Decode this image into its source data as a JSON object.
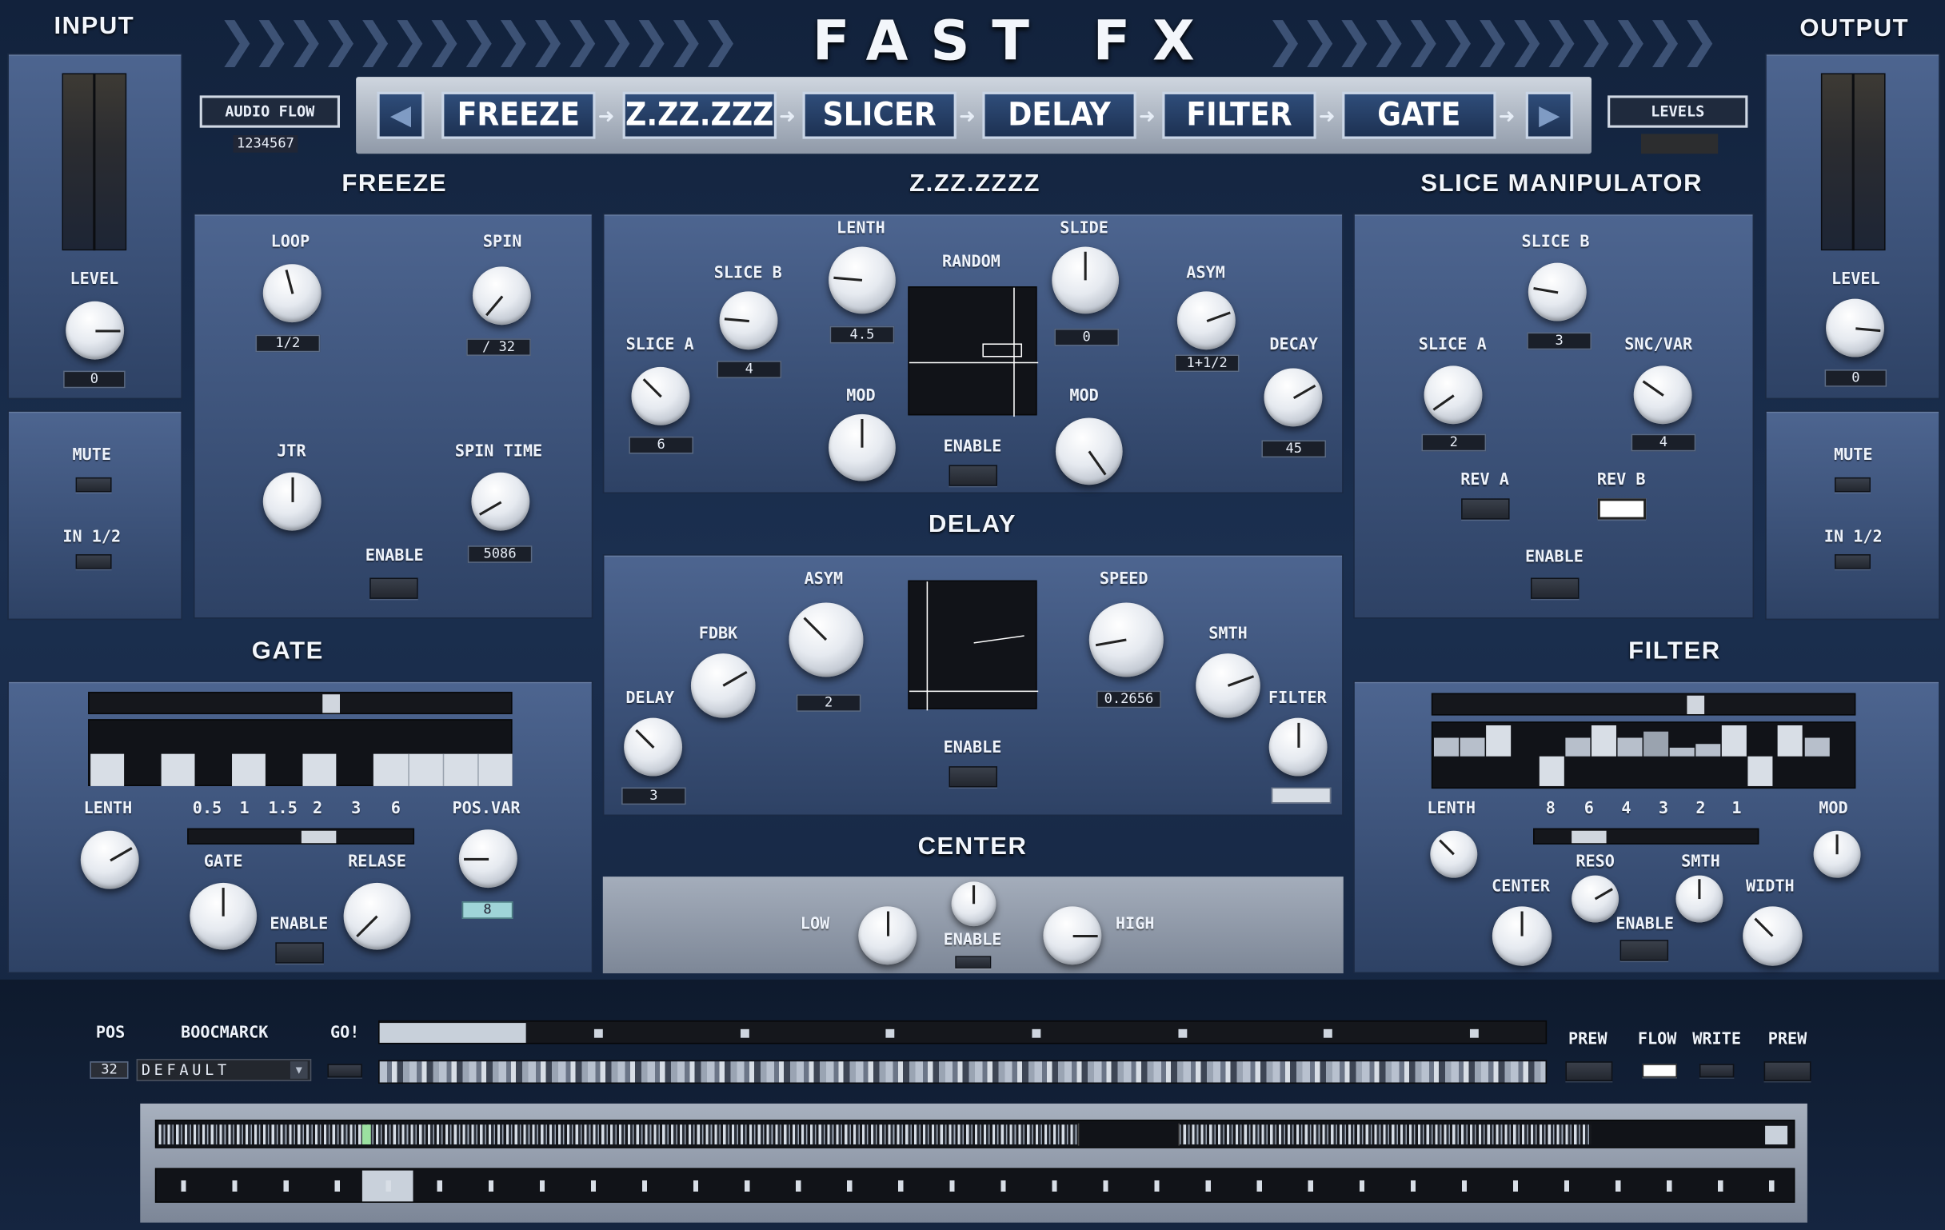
{
  "app": {
    "title": "FAST FX",
    "input_label": "INPUT",
    "output_label": "OUTPUT"
  },
  "top": {
    "audio_flow": "AUDIO FLOW",
    "audio_flow_value": "1234567",
    "levels": "LEVELS",
    "chain": [
      "FREEZE",
      "Z.ZZ.ZZZ",
      "SLICER",
      "DELAY",
      "FILTER",
      "GATE"
    ]
  },
  "input": {
    "level_label": "LEVEL",
    "level_value": "0",
    "mute": "MUTE",
    "in": "IN 1/2"
  },
  "output": {
    "level_label": "LEVEL",
    "level_value": "0",
    "mute": "MUTE",
    "in": "IN 1/2"
  },
  "freeze": {
    "title": "FREEZE",
    "loop": "LOOP",
    "loop_value": "1/2",
    "spin": "SPIN",
    "spin_value": "/ 32",
    "jtr": "JTR",
    "spin_time": "SPIN TIME",
    "spin_time_value": "5086",
    "enable": "ENABLE"
  },
  "zz": {
    "title": "Z.ZZ.ZZZZ",
    "slice_a": "SLICE A",
    "slice_a_value": "6",
    "slice_b": "SLICE B",
    "slice_b_value": "4",
    "lenth": "LENTH",
    "lenth_value": "4.5",
    "mod1": "MOD",
    "random": "RANDOM",
    "enable": "ENABLE",
    "slide": "SLIDE",
    "slide_value": "0",
    "mod2": "MOD",
    "asym": "ASYM",
    "asym_value": "1+1/2",
    "decay": "DECAY",
    "decay_value": "45"
  },
  "slicer": {
    "title": "SLICE MANIPULATOR",
    "slice_b": "SLICE B",
    "slice_b_value": "3",
    "slice_a": "SLICE A",
    "slice_a_value": "2",
    "snc": "SNC/VAR",
    "snc_value": "4",
    "rev_a": "REV A",
    "rev_b": "REV B",
    "enable": "ENABLE"
  },
  "delay": {
    "title": "DELAY",
    "delay": "DELAY",
    "delay_value": "3",
    "fdbk": "FDBK",
    "asym": "ASYM",
    "asym_value": "2",
    "enable": "ENABLE",
    "speed": "SPEED",
    "speed_value": "0.2656",
    "smth": "SMTH",
    "filter": "FILTER"
  },
  "center": {
    "title": "CENTER",
    "low": "LOW",
    "enable": "ENABLE",
    "high": "HIGH"
  },
  "gate": {
    "title": "GATE",
    "lenth": "LENTH",
    "scale": [
      "0.5",
      "1",
      "1.5",
      "2",
      "3",
      "6"
    ],
    "posvar": "POS.VAR",
    "posvar_value": "8",
    "gate": "GATE",
    "relase": "RELASE",
    "enable": "ENABLE"
  },
  "filter": {
    "title": "FILTER",
    "lenth": "LENTH",
    "scale": [
      "8",
      "6",
      "4",
      "3",
      "2",
      "1"
    ],
    "mod": "MOD",
    "center": "CENTER",
    "reso": "RESO",
    "smth": "SMTH",
    "width": "WIDTH",
    "enable": "ENABLE"
  },
  "bottom": {
    "pos": "POS",
    "pos_value": "32",
    "bookmark": "BOOCMARCK",
    "bookmark_value": "DEFAULT",
    "go": "GO!",
    "prew1": "PREW",
    "flow": "FLOW",
    "write": "WRITE",
    "prew2": "PREW"
  },
  "colors": {
    "panel": "#3f557c",
    "background": "#14243e",
    "display": "#111318",
    "accent": "#9fd4d8"
  }
}
